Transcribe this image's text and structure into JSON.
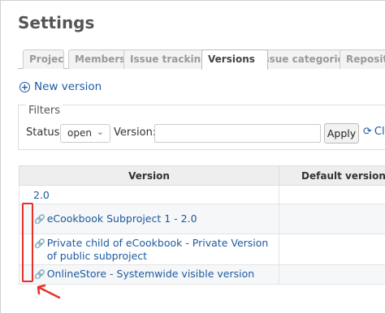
{
  "page": {
    "title": "Settings"
  },
  "tabs": [
    {
      "label": "Project",
      "selected": false
    },
    {
      "label": "Members",
      "selected": false
    },
    {
      "label": "Issue tracking",
      "selected": false
    },
    {
      "label": "Versions",
      "selected": true
    },
    {
      "label": "Issue categories",
      "selected": false
    },
    {
      "label": "Repositories",
      "selected": false
    }
  ],
  "actions": {
    "new_version": "New version",
    "new_version_icon": "plus-circle-icon"
  },
  "filters": {
    "legend": "Filters",
    "status_label": "Status:",
    "status_value": "open",
    "version_label": "Version:",
    "version_value": "",
    "apply_label": "Apply",
    "clear_label": "Clear"
  },
  "table": {
    "headers": {
      "version": "Version",
      "default_version": "Default version"
    },
    "rows": [
      {
        "name": "2.0",
        "has_link_icon": false
      },
      {
        "name": "eCookbook Subproject 1 - 2.0",
        "has_link_icon": true
      },
      {
        "name": "Private child of eCookbook - Private Version of public subproject",
        "has_link_icon": true
      },
      {
        "name": "OnlineStore - Systemwide visible version",
        "has_link_icon": true
      }
    ]
  },
  "colors": {
    "link": "#1e5aa0",
    "annotation": "#e5312a",
    "table_header": "#eeeeee"
  }
}
